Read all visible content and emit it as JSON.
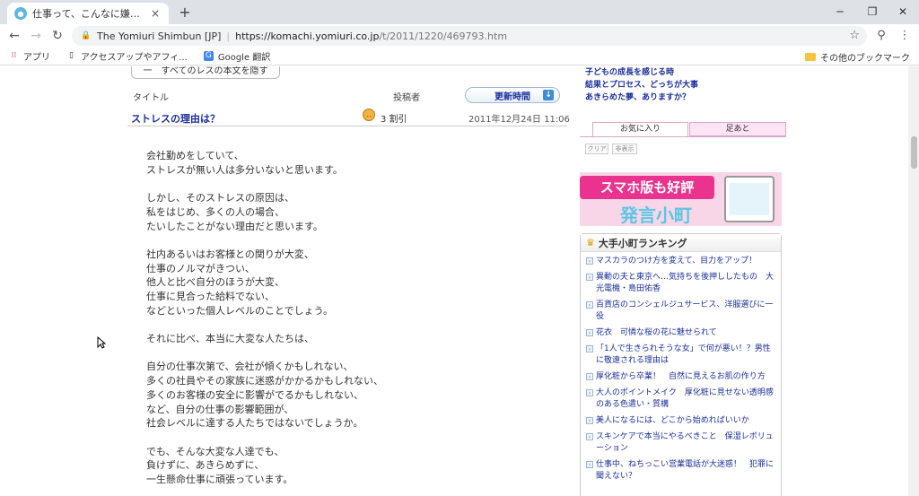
{
  "browser": {
    "tab_title": "仕事って、こんなに嫌なものですか？：",
    "tab_close": "×",
    "new_tab": "+",
    "win_min": "─",
    "win_max": "❐",
    "win_close": "✕",
    "site_identity": "The Yomiuri Shimbun [JP]",
    "url_host": "https://komachi.yomiuri.co.jp",
    "url_path": "/t/2011/1220/469793.htm",
    "bookmarks": [
      {
        "label": "アプリ",
        "icon": "apps-grid-icon"
      },
      {
        "label": "アクセスアップやアフィ...",
        "icon": "page-icon"
      },
      {
        "label": "Google 翻訳",
        "icon": "google-translate-icon"
      }
    ],
    "other_bookmarks": "その他のブックマーク"
  },
  "page": {
    "show_all": "一　すべてのレスの本文を隠す",
    "col_title": "タイトル",
    "col_author": "投稿者",
    "sort_button": "更新時間",
    "thread": {
      "title": "ストレスの理由は？",
      "author": "3 割引",
      "date": "2011年12月24日 11:06"
    },
    "body_paragraphs": [
      "会社勤めをしていて、\nストレスが無い人は多分いないと思います。",
      "しかし、そのストレスの原因は、\n私をはじめ、多くの人の場合、\nたいしたことがない理由だと思います。",
      "社内あるいはお客様との関りが大変、\n仕事のノルマがきつい、\n他人と比べ自分のほうが大変、\n仕事に見合った給料でない、\nなどといった個人レベルのことでしょう。",
      "それに比べ、本当に大変な人たちは、",
      "自分の仕事次第で、会社が傾くかもしれない、\n多くの社員やその家族に迷惑がかかるかもしれない、\n多くのお客様の安全に影響がでるかもしれない、\nなど、自分の仕事の影響範囲が、\n社会レベルに達する人たちではないでしょうか。",
      "でも、そんな大変な人達でも、\n負けずに、あきらめずに、\n一生懸命仕事に頑張っています。"
    ]
  },
  "sidebar": {
    "top_links": [
      "子どもの成長を感じる時",
      "結果とプロセス、どっちが大事",
      "あきらめた夢、ありますか？"
    ],
    "tab_favorites": "お気に入り",
    "tab_trail": "足あと",
    "btn_clear": "クリア",
    "btn_hide": "非表示",
    "banner_top": "スマホ版も好評",
    "banner_bottom": "発言小町",
    "ranking_title": "大手小町ランキング",
    "ranking_items": [
      "マスカラのつけ方を変えて、目力をアップ！",
      "異動の夫と東京へ…気持ちを後押ししたもの　大光電機・島田佑香",
      "百貨店のコンシェルジュサービス、洋服選びに一役",
      "花衣　可憐な桜の花に魅せられて",
      "「1人で生きられそうな女」で何が悪い！？男性に敬遠される理由は",
      "厚化粧から卒業！　自然に見えるお肌の作り方",
      "大人のポイントメイク　厚化粧に見せない透明感のある色遣い・質構",
      "美人になるには、どこから始めればいいか",
      "スキンケアで本当にやるべきこと　保湿レボリューション",
      "仕事中、ねちっこい営業電話が大迷惑！　犯罪に聞えない？"
    ]
  }
}
